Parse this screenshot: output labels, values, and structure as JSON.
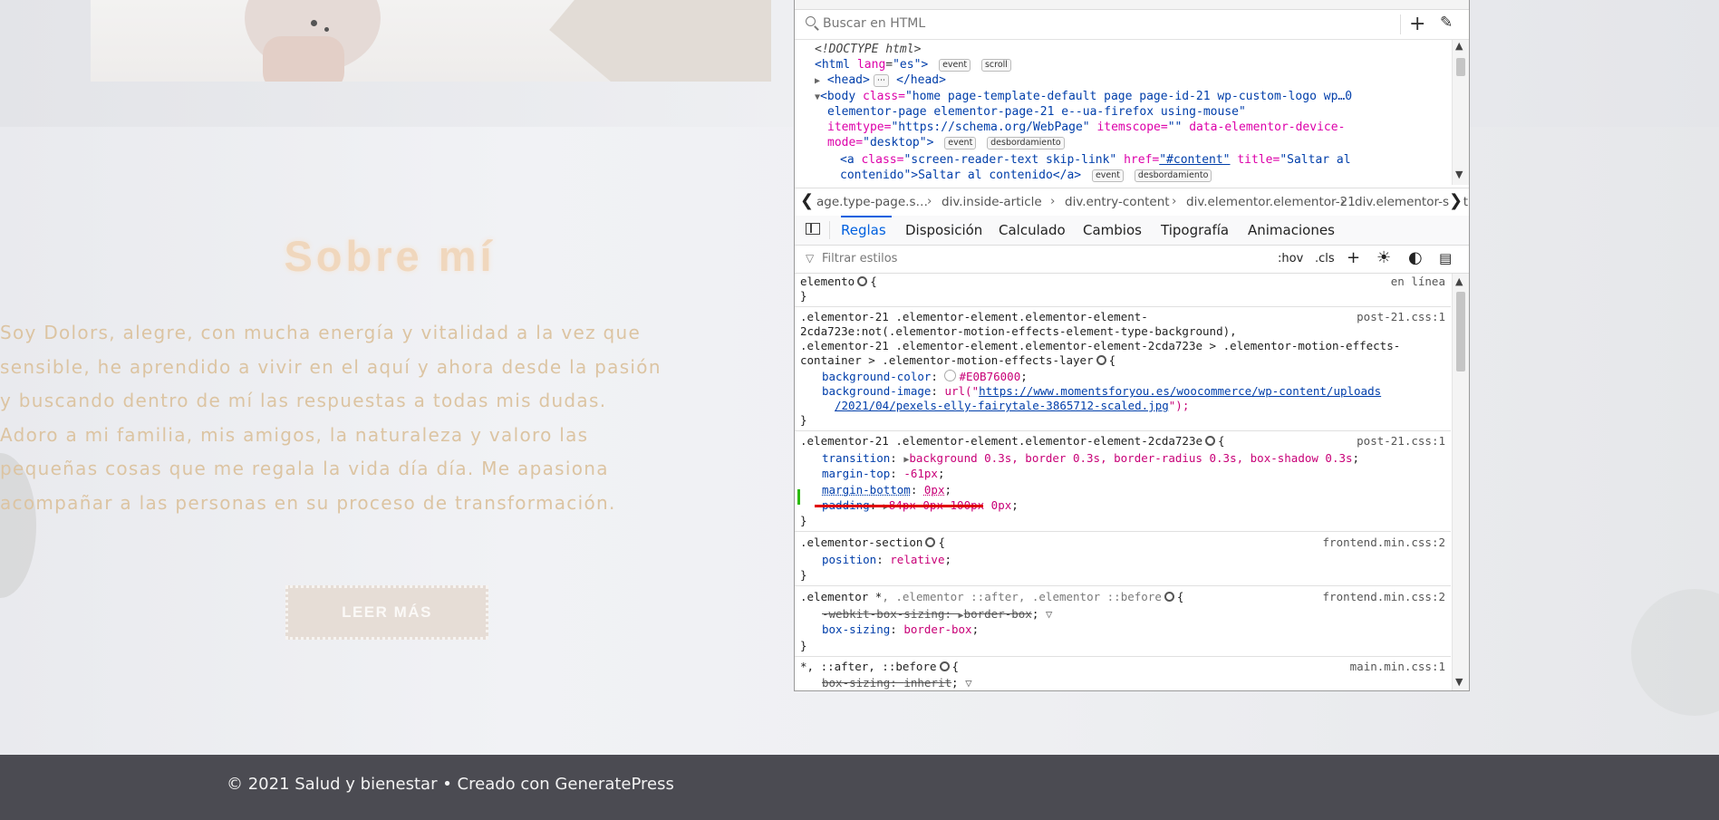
{
  "website": {
    "about_title": "Sobre mí",
    "about_lines": [
      "Soy Dolors, alegre, con mucha energía y vitalidad a la vez que",
      "sensible, he aprendido a vivir en el aquí y ahora desde la pasión",
      "y buscando dentro de mí las respuestas a todas mis dudas.",
      "Adoro a mi familia, mis amigos, la naturaleza y valoro las",
      "pequeñas cosas que me regala la vida día día. Me apasiona",
      "acompañar a las personas en su proceso de transformación."
    ],
    "button_label": "LEER MÁS",
    "footer": "© 2021 Salud y bienestar • Creado con GeneratePress"
  },
  "devtools": {
    "search_placeholder": "Buscar en HTML",
    "html_tree": {
      "doctype": "<!DOCTYPE html>",
      "html_tag": "html",
      "html_lang_attr": "lang",
      "html_lang_val": "\"es\"",
      "badge_event": "event",
      "badge_scroll": "scroll",
      "badge_overflow": "desbordamiento",
      "head_open": "<head>",
      "head_ellipsis": "⋯",
      "head_close": "</head>",
      "body_line1_tag": "<body",
      "body_class_attr": "class=",
      "body_class_val": "\"home page-template-default page page-id-21 wp-custom-logo wp…0",
      "body_line2": "elementor-page elementor-page-21 e--ua-firefox using-mouse\"",
      "body_line3_attr": "itemtype=",
      "body_line3_val": "\"https://schema.org/WebPage\"",
      "body_line3_attr2": "itemscope=",
      "body_line3_val2": "\"\"",
      "body_line3_attr3": "data-elementor-device-",
      "body_line4_attr": "mode=",
      "body_line4_val": "\"desktop\"",
      "a_tag": "<a",
      "a_class_attr": "class=",
      "a_class_val": "\"screen-reader-text skip-link\"",
      "a_href_attr": "href=",
      "a_href_val": "\"#content\"",
      "a_title_attr": "title=",
      "a_title_val": "\"Saltar al",
      "a_line2": "contenido\">Saltar al contenido</a>"
    },
    "breadcrumbs": [
      "age.type-page.s…",
      "div.inside-article",
      "div.entry-content",
      "div.elementor.elementor-21",
      "div.elementor-sect"
    ],
    "tabs": [
      "Reglas",
      "Disposición",
      "Calculado",
      "Cambios",
      "Tipografía",
      "Animaciones"
    ],
    "filter_placeholder": "Filtrar estilos",
    "filter_hov": ":hov",
    "filter_cls": ".cls",
    "rules": {
      "r1_selector": "elemento",
      "r1_source": "en línea",
      "r2_sel1": ".elementor-21 .elementor-element.elementor-element-",
      "r2_sel2": "2cda723e:not(.elementor-motion-effects-element-type-background),",
      "r2_sel3": ".elementor-21 .elementor-element.elementor-element-2cda723e > .elementor-motion-effects-",
      "r2_sel4": "container > .elementor-motion-effects-layer",
      "r2_source": "post-21.css:1",
      "r2_p1": "background-color",
      "r2_v1": "#E0B76000",
      "r2_p2": "background-image",
      "r2_v2_pre": "url(\"",
      "r2_v2_link1": "https://www.momentsforyou.es/woocommerce/wp-content/uploads",
      "r2_v2_link2": "/2021/04/pexels-elly-fairytale-3865712-scaled.jpg",
      "r2_v2_post": "\");",
      "r3_selector": ".elementor-21 .elementor-element.elementor-element-2cda723e",
      "r3_source": "post-21.css:1",
      "r3_p1": "transition",
      "r3_v1": "background 0.3s, border 0.3s, border-radius 0.3s, box-shadow 0.3s",
      "r3_p2": "margin-top",
      "r3_v2": "-61px",
      "r3_p3": "margin-bottom",
      "r3_v3": "0px",
      "r3_p4": "padding",
      "r3_v4": "84px 0px 100px 0px",
      "r4_selector": ".elementor-section",
      "r4_source": "frontend.min.css:2",
      "r4_p1": "position",
      "r4_v1": "relative",
      "r5_selector_a": ".elementor *",
      "r5_selector_b": ", .elementor ::after, .elementor ::before",
      "r5_source": "frontend.min.css:2",
      "r5_p1": "-webkit-box-sizing",
      "r5_v1": "border-box",
      "r5_p2": "box-sizing",
      "r5_v2": "border-box",
      "r6_selector": "*, ::after, ::before",
      "r6_source": "main.min.css:1",
      "r6_p1": "box-sizing",
      "r6_v1": "inherit"
    }
  }
}
